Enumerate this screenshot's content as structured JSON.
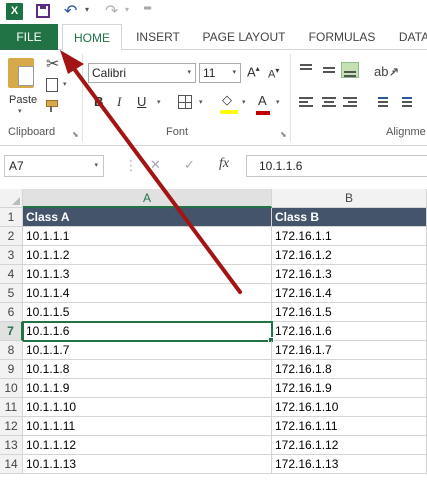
{
  "qat": {
    "app_icon": "excel-logo-icon",
    "app_letter": "X",
    "buttons": [
      "save-icon",
      "undo-icon",
      "redo-icon",
      "customize-qat-icon"
    ]
  },
  "ribbon_tabs": {
    "file": "FILE",
    "home": "HOME",
    "insert": "INSERT",
    "page_layout": "PAGE LAYOUT",
    "formulas": "FORMULAS",
    "data": "DATA"
  },
  "clipboard": {
    "paste_label": "Paste",
    "group_label": "Clipboard"
  },
  "font": {
    "font_name": "Calibri",
    "font_size": "11",
    "bold": "B",
    "italic": "I",
    "underline": "U",
    "grow": "A",
    "shrink": "A",
    "fill_glyph": "◇",
    "color_glyph": "A",
    "group_label": "Font"
  },
  "alignment": {
    "group_label": "Alignme"
  },
  "formula_bar": {
    "name_box": "A7",
    "fx": "fx",
    "value": "10.1.1.6"
  },
  "grid": {
    "columns": [
      "A",
      "B"
    ],
    "selected_column": "A",
    "selected_row": "7",
    "active_cell": "A7",
    "rows": [
      {
        "num": "1",
        "a": "Class A",
        "b": "Class B"
      },
      {
        "num": "2",
        "a": "10.1.1.1",
        "b": "172.16.1.1"
      },
      {
        "num": "3",
        "a": "10.1.1.2",
        "b": "172.16.1.2"
      },
      {
        "num": "4",
        "a": "10.1.1.3",
        "b": "172.16.1.3"
      },
      {
        "num": "5",
        "a": "10.1.1.4",
        "b": "172.16.1.4"
      },
      {
        "num": "6",
        "a": "10.1.1.5",
        "b": "172.16.1.5"
      },
      {
        "num": "7",
        "a": "10.1.1.6",
        "b": "172.16.1.6"
      },
      {
        "num": "8",
        "a": "10.1.1.7",
        "b": "172.16.1.7"
      },
      {
        "num": "9",
        "a": "10.1.1.8",
        "b": "172.16.1.8"
      },
      {
        "num": "10",
        "a": "10.1.1.9",
        "b": "172.16.1.9"
      },
      {
        "num": "11",
        "a": "10.1.1.10",
        "b": "172.16.1.10"
      },
      {
        "num": "12",
        "a": "10.1.1.11",
        "b": "172.16.1.11"
      },
      {
        "num": "13",
        "a": "10.1.1.12",
        "b": "172.16.1.12"
      },
      {
        "num": "14",
        "a": "10.1.1.13",
        "b": "172.16.1.13"
      }
    ]
  },
  "annotation": {
    "arrow_color": "#a31515",
    "points_to": "FILE"
  },
  "colors": {
    "excel_green": "#217346",
    "header_fill": "#44546a",
    "accent_red": "#a31515"
  }
}
